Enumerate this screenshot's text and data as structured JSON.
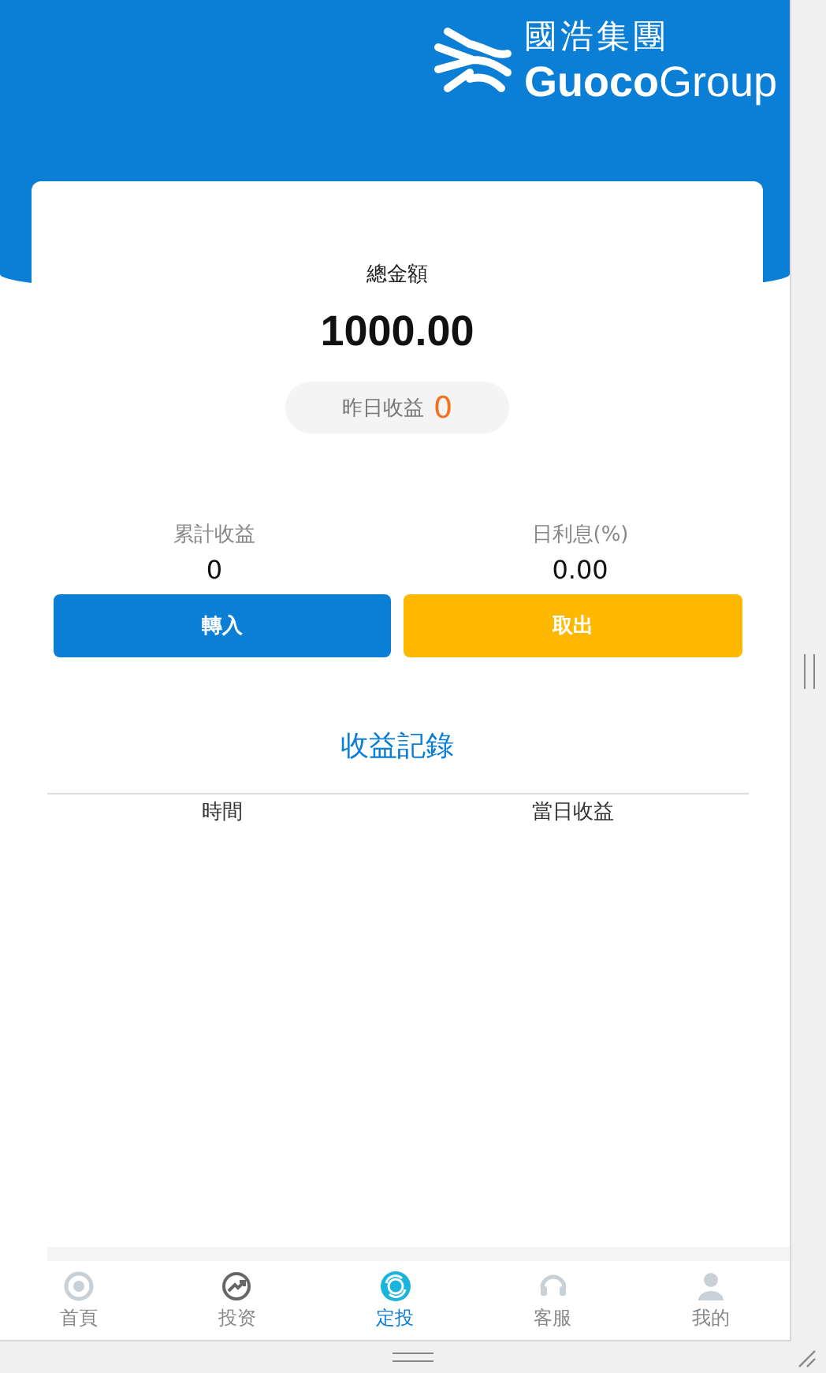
{
  "logo": {
    "chinese": "國浩集團",
    "brand_bold": "Guoco",
    "brand_light": "Group"
  },
  "summary": {
    "label": "總金額",
    "amount": "1000.00",
    "yesterday_label": "昨日收益",
    "yesterday_value": "0"
  },
  "stats": [
    {
      "label": "累計收益",
      "value": "0"
    },
    {
      "label": "日利息(%)",
      "value": "0.00"
    }
  ],
  "buttons": [
    {
      "label": "轉入",
      "kind": "primary"
    },
    {
      "label": "取出",
      "kind": "warning"
    }
  ],
  "records": {
    "title": "收益記錄",
    "columns": [
      "時間",
      "當日收益"
    ]
  },
  "nav": [
    {
      "label": "首頁",
      "kind": "home",
      "selected": false
    },
    {
      "label": "投资",
      "kind": "invest",
      "selected": false
    },
    {
      "label": "定投",
      "kind": "fixed",
      "selected": true
    },
    {
      "label": "客服",
      "kind": "service",
      "selected": false
    },
    {
      "label": "我的",
      "kind": "user",
      "selected": false
    }
  ]
}
